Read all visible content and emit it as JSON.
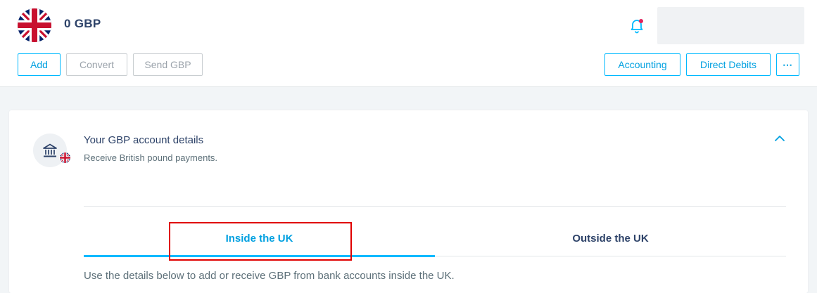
{
  "header": {
    "currency_icon": "uk-flag-icon",
    "balance": "0 GBP",
    "bell_icon": "bell-notification-icon",
    "actions_left": {
      "add": "Add",
      "convert": "Convert",
      "send": "Send GBP"
    },
    "actions_right": {
      "accounting": "Accounting",
      "direct_debits": "Direct Debits",
      "more": "⋯"
    }
  },
  "account_card": {
    "icon": "bank-icon",
    "title": "Your GBP account details",
    "subtitle": "Receive British pound payments.",
    "tabs": [
      {
        "label": "Inside the UK",
        "active": true
      },
      {
        "label": "Outside the UK",
        "active": false
      }
    ],
    "info_text": "Use the details below to add or receive GBP from bank accounts inside the UK."
  },
  "colors": {
    "accent": "#00b9ff",
    "text_dark": "#2e4369",
    "text_muted": "#5d7079",
    "highlight": "#e00000"
  }
}
